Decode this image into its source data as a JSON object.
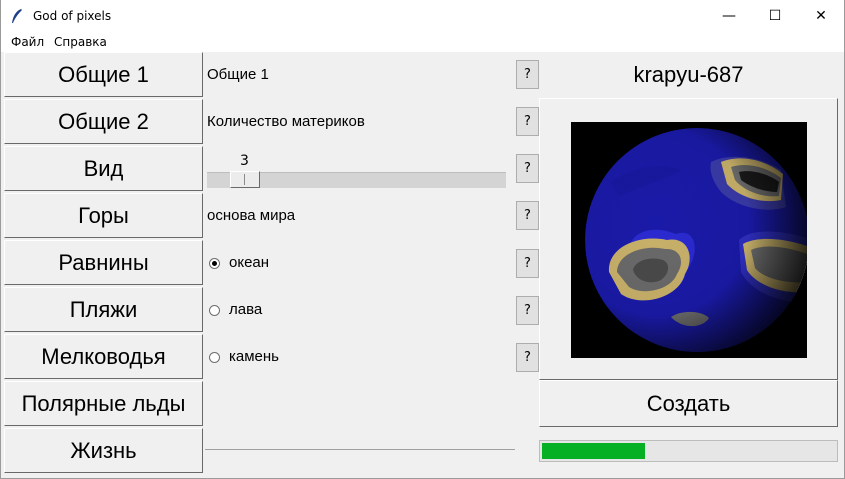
{
  "window": {
    "title": "God of pixels",
    "minimize_glyph": "—",
    "maximize_glyph": "☐",
    "close_glyph": "✕"
  },
  "menu": [
    "Файл",
    "Справка"
  ],
  "nav": [
    "Общие 1",
    "Общие 2",
    "Вид",
    "Горы",
    "Равнины",
    "Пляжи",
    "Мелководья",
    "Полярные льды",
    "Жизнь"
  ],
  "settings": {
    "section_label": "Общие 1",
    "continents_label": "Количество материков",
    "continents_value": "3",
    "continents_slider": {
      "min": 1,
      "max": 13,
      "value": 3
    },
    "world_base_label": "основа мира",
    "world_base_options": [
      {
        "label": "океан",
        "selected": true
      },
      {
        "label": "лава",
        "selected": false
      },
      {
        "label": "камень",
        "selected": false
      }
    ],
    "help_label": "?"
  },
  "preview": {
    "world_name": "krapyu-687",
    "create_label": "Создать",
    "progress": 0.35,
    "colors": {
      "ocean": "#1a1aa8",
      "sand": "#c8b16a",
      "rock": "#5e5e5e",
      "progress": "#06b025"
    }
  }
}
